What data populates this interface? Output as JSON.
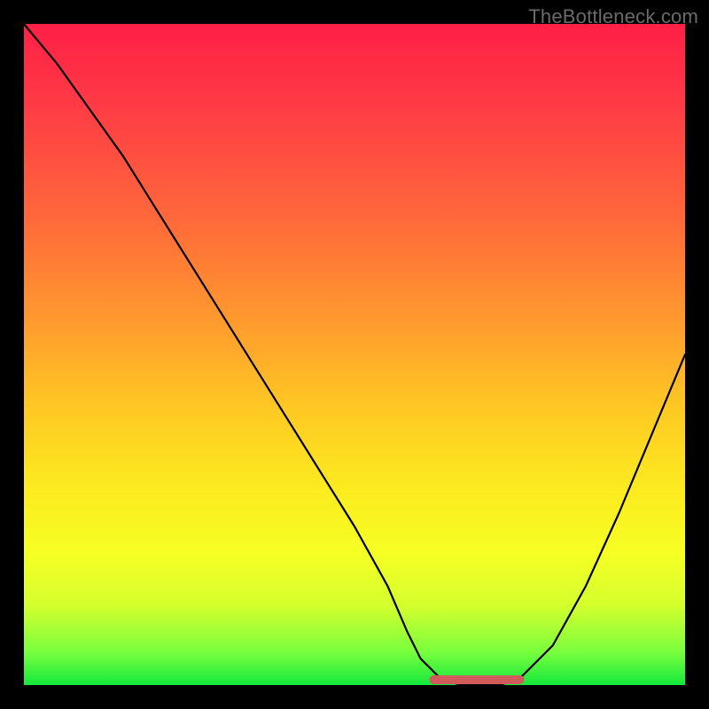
{
  "watermark": "TheBottleneck.com",
  "colors": {
    "gradient_top": "#ff1f46",
    "gradient_mid": "#ffc823",
    "gradient_bottom": "#14e83c",
    "curve": "#000000",
    "marker": "#d15a5a",
    "frame": "#000000"
  },
  "chart_data": {
    "type": "line",
    "title": "",
    "xlabel": "",
    "ylabel": "",
    "xlim": [
      0,
      100
    ],
    "ylim": [
      0,
      100
    ],
    "grid": false,
    "legend": false,
    "series": [
      {
        "name": "bottleneck-curve",
        "x": [
          0,
          5,
          10,
          15,
          20,
          25,
          30,
          35,
          40,
          45,
          50,
          55,
          58,
          60,
          63,
          66,
          69,
          72,
          75,
          80,
          85,
          90,
          95,
          100
        ],
        "y": [
          100,
          94,
          87,
          80,
          72,
          64,
          56,
          48,
          40,
          32,
          24,
          15,
          8,
          4,
          1,
          0,
          0,
          0,
          1,
          6,
          15,
          26,
          38,
          50
        ]
      }
    ],
    "annotations": [
      {
        "name": "min-plateau-marker",
        "x_range": [
          62,
          75
        ],
        "y": 0,
        "color": "#d15a5a"
      }
    ]
  }
}
